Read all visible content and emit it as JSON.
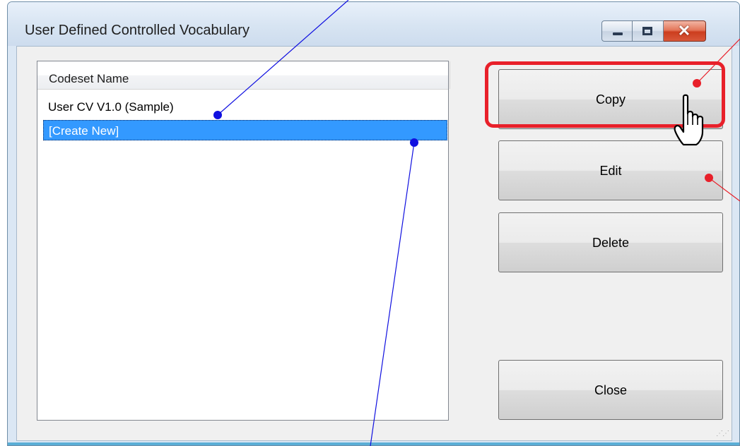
{
  "window": {
    "title": "User Defined Controlled Vocabulary",
    "controls": {
      "close_glyph": "✕"
    }
  },
  "listview": {
    "column_header": "Codeset Name",
    "rows": [
      "User CV V1.0 (Sample)",
      "[Create New]"
    ],
    "selected_index": 1
  },
  "buttons": {
    "copy": "Copy",
    "edit": "Edit",
    "delete": "Delete",
    "close": "Close"
  },
  "annotations": {
    "highlight_color": "#e8202a",
    "blue_marker_color": "#1010e0",
    "red_marker_color": "#e8202a"
  },
  "icons": [
    "minimize-icon",
    "maximize-icon",
    "close-icon",
    "hand-cursor-icon",
    "resize-grip-icon"
  ]
}
